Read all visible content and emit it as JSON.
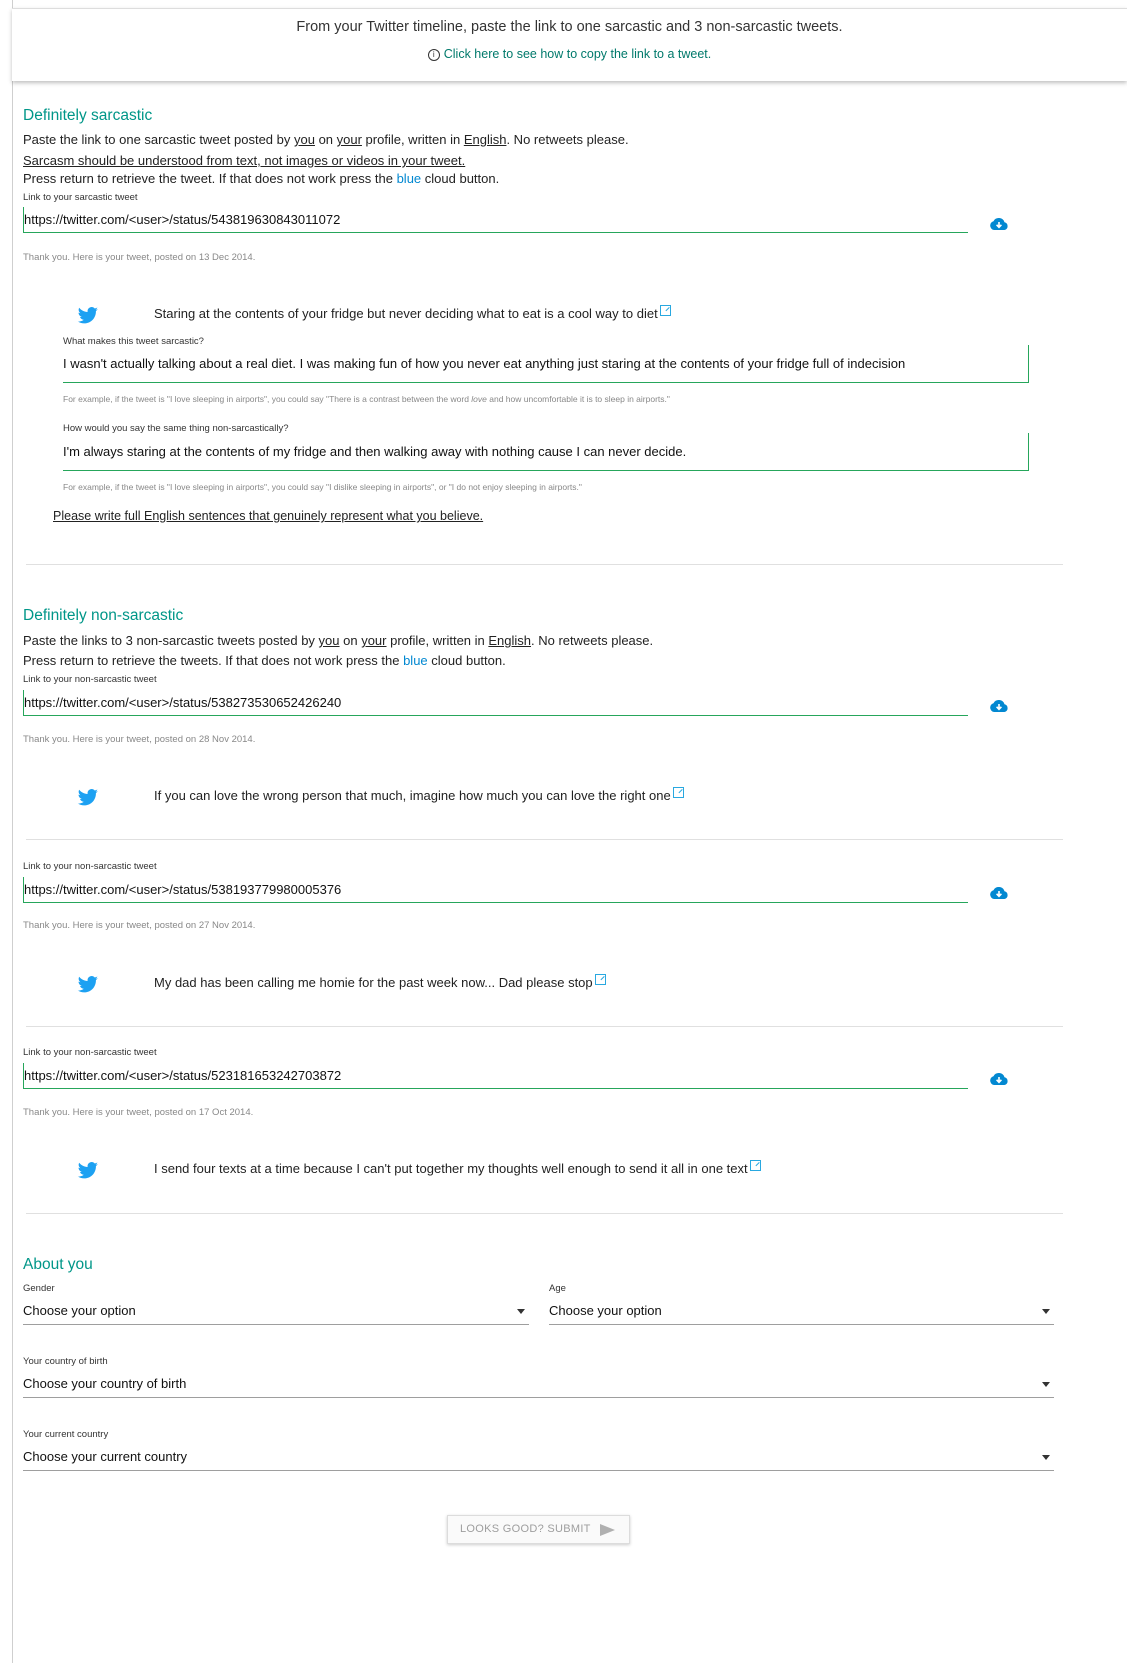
{
  "header": {
    "instruction": "From your Twitter timeline, paste the link to one sarcastic and 3 non-sarcastic tweets.",
    "help_link": "Click here to see how to copy the link to a tweet."
  },
  "sarcastic": {
    "title": "Definitely sarcastic",
    "line1_a": "Paste the link to one sarcastic tweet posted by ",
    "line1_you": "you",
    "line1_b": " on ",
    "line1_your": "your",
    "line1_c": " profile, written in ",
    "line1_english": "English",
    "line1_d": ". No retweets please.",
    "line2": "Sarcasm should be understood from text, not images or videos in your tweet.",
    "line3_a": "Press return to retrieve the tweet. If that does not work press the ",
    "line3_blue": "blue",
    "line3_b": " cloud button.",
    "field_label": "Link to your sarcastic tweet",
    "field_value": "https://twitter.com/<user>/status/543819630843011072",
    "thanks": "Thank you. Here is your tweet, posted on 13 Dec 2014.",
    "tweet_text": "Staring at the contents of your fridge but never deciding what to eat is a cool way to diet",
    "q1_label": "What makes this tweet sarcastic?",
    "q1_value": "I wasn't actually talking about a real diet. I was making fun of how you never eat anything just staring at the contents of your fridge full of indecision",
    "q1_hint_a": "For example, if the tweet is \"I love sleeping in airports\", you could say \"There is a contrast between the word ",
    "q1_hint_love": "love",
    "q1_hint_b": " and how uncomfortable it is to sleep in airports.\"",
    "q2_label": "How would you say the same thing non-sarcastically?",
    "q2_value": "I'm always staring at the contents of my fridge and then walking away with nothing cause I can never decide.",
    "q2_hint": "For example, if the tweet is \"I love sleeping in airports\", you could say \"I dislike sleeping in airports\", or \"I do not enjoy sleeping in airports.\"",
    "note": "Please write full English sentences that genuinely represent what you believe."
  },
  "nonsarcastic": {
    "title": "Definitely non-sarcastic",
    "line1_a": "Paste the links to 3 non-sarcastic tweets posted by ",
    "line1_you": "you",
    "line1_b": " on ",
    "line1_your": "your",
    "line1_c": " profile, written in ",
    "line1_english": "English",
    "line1_d": ". No retweets please.",
    "line2_a": "Press return to retrieve the tweets. If that does not work press the ",
    "line2_blue": "blue",
    "line2_b": " cloud button.",
    "entries": [
      {
        "label": "Link to your non-sarcastic tweet",
        "value": "https://twitter.com/<user>/status/538273530652426240",
        "thanks": "Thank you. Here is your tweet, posted on 28 Nov 2014.",
        "tweet": "If you can love the wrong person that much, imagine how much you can love the right one"
      },
      {
        "label": "Link to your non-sarcastic tweet",
        "value": "https://twitter.com/<user>/status/538193779980005376",
        "thanks": "Thank you. Here is your tweet, posted on 27 Nov 2014.",
        "tweet": "My dad has been calling me homie for the past week now... Dad please stop"
      },
      {
        "label": "Link to your non-sarcastic tweet",
        "value": "https://twitter.com/<user>/status/523181653242703872",
        "thanks": "Thank you. Here is your tweet, posted on 17 Oct 2014.",
        "tweet": "I send four texts at a time because I can't put together my thoughts well enough to send it all in one text"
      }
    ]
  },
  "about": {
    "title": "About you",
    "gender_label": "Gender",
    "gender_value": "Choose your option",
    "age_label": "Age",
    "age_value": "Choose your option",
    "birth_label": "Your country of birth",
    "birth_value": "Choose your country of birth",
    "current_label": "Your current country",
    "current_value": "Choose your current country"
  },
  "submit_label": "LOOKS GOOD? SUBMIT",
  "colors": {
    "accent": "#009688",
    "field_line": "#26a65b",
    "twitter": "#1da1f2",
    "cloud": "#0288d1",
    "link_blue": "#0288d1"
  },
  "icons": {
    "info": "info-icon",
    "cloud": "cloud-download-icon",
    "twitter": "twitter-bird-icon",
    "external": "external-link-icon",
    "send": "send-icon",
    "caret": "caret-down-icon"
  }
}
